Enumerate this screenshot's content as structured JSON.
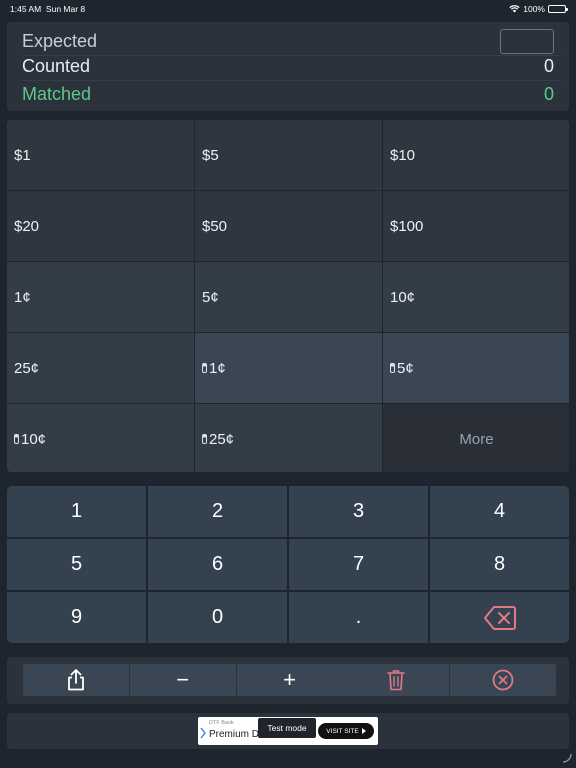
{
  "status_bar": {
    "time": "1:45 AM",
    "date": "Sun Mar 8",
    "battery": "100%"
  },
  "summary": {
    "expected_label": "Expected",
    "expected_value": "",
    "counted_label": "Counted",
    "counted_value": "0",
    "matched_label": "Matched",
    "matched_value": "0",
    "matched_color": "#5cc98a"
  },
  "denominations": [
    {
      "label": "$1",
      "kind": "bill"
    },
    {
      "label": "$5",
      "kind": "bill"
    },
    {
      "label": "$10",
      "kind": "bill"
    },
    {
      "label": "$20",
      "kind": "bill"
    },
    {
      "label": "$50",
      "kind": "bill"
    },
    {
      "label": "$100",
      "kind": "bill"
    },
    {
      "label": "1¢",
      "kind": "coin"
    },
    {
      "label": "5¢",
      "kind": "coin"
    },
    {
      "label": "10¢",
      "kind": "coin"
    },
    {
      "label": "25¢",
      "kind": "coin"
    },
    {
      "label": "1¢",
      "kind": "roll"
    },
    {
      "label": "5¢",
      "kind": "roll"
    },
    {
      "label": "10¢",
      "kind": "roll"
    },
    {
      "label": "25¢",
      "kind": "roll"
    },
    {
      "label": "More",
      "kind": "more"
    }
  ],
  "keypad": {
    "keys": [
      "1",
      "2",
      "3",
      "4",
      "5",
      "6",
      "7",
      "8",
      "9",
      "0",
      "."
    ],
    "backspace_icon": "backspace-icon",
    "backspace_color": "#e07a85"
  },
  "toolbar": {
    "share_icon": "share-icon",
    "minus": "−",
    "plus": "+",
    "delete_icon": "trash-icon",
    "clear_icon": "clear-circle-icon",
    "accent": "#e07a85"
  },
  "ad": {
    "brand": "DTF Bank",
    "title": "Premium D",
    "test_mode": "Test mode",
    "visit_label": "VISIT SITE"
  }
}
